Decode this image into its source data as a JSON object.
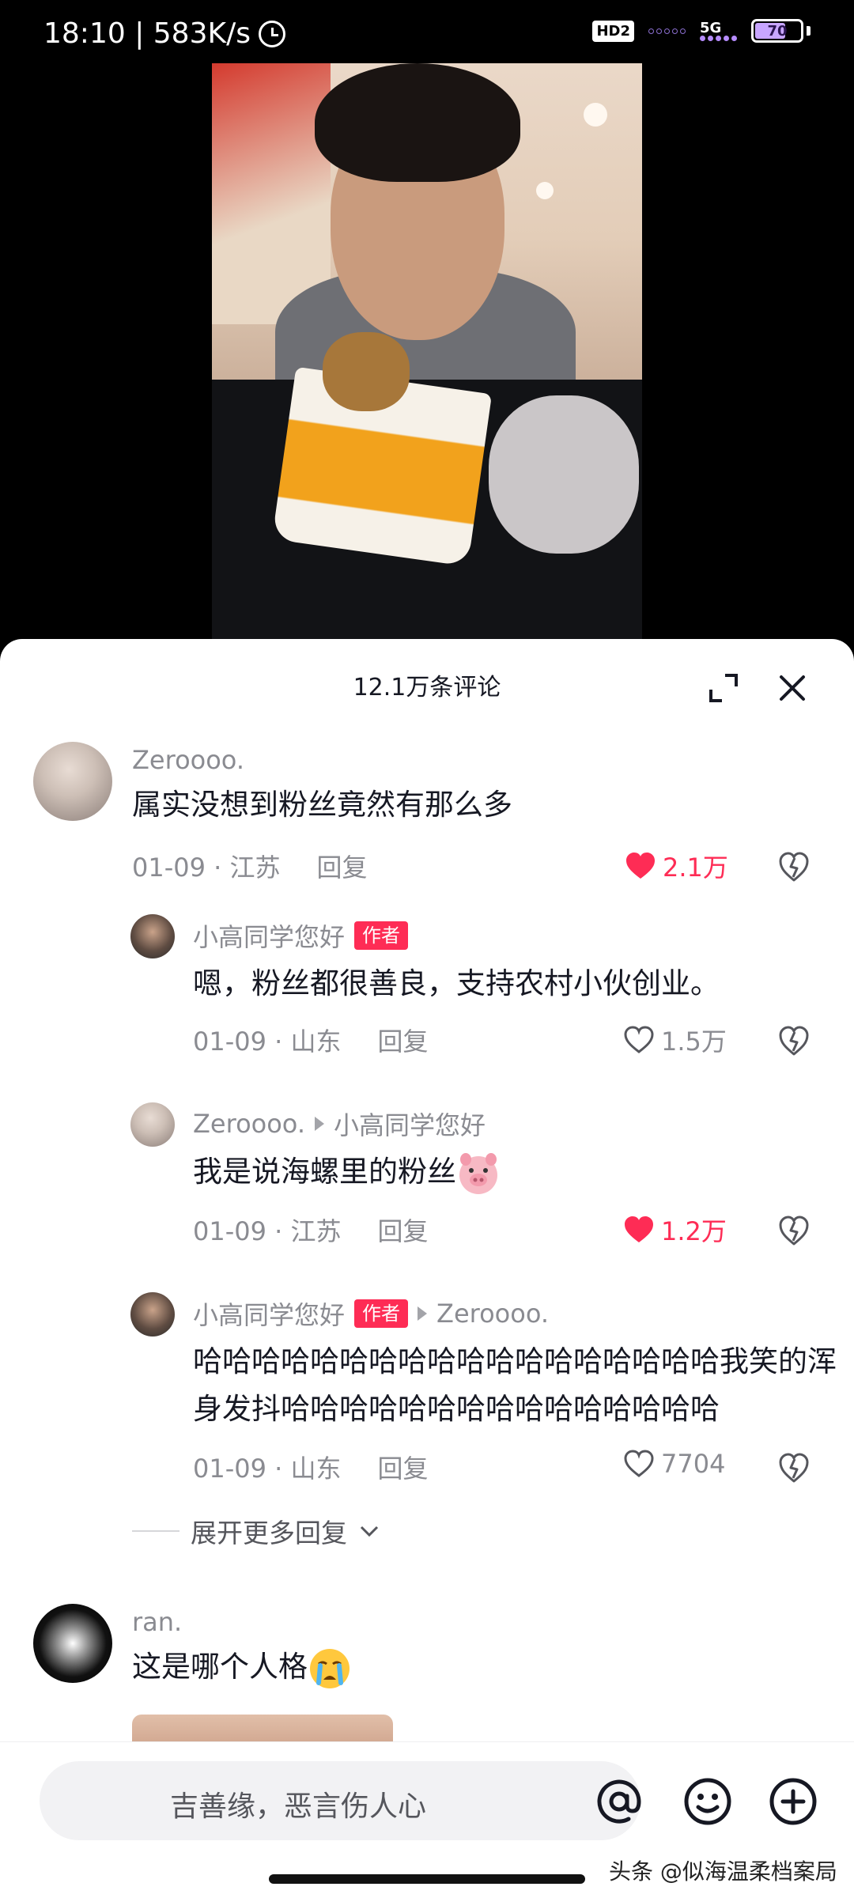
{
  "status_bar": {
    "time_speed": "18:10 | 583K/s",
    "hd_badge": "HD2",
    "network": "5G",
    "battery": "70",
    "battery_level": 0.7
  },
  "sheet": {
    "title": "12.1万条评论"
  },
  "comments": [
    {
      "username": "Zeroooo.",
      "text": "属实没想到粉丝竟然有那么多",
      "date_location": "01-09 · 江苏",
      "reply_label": "回复",
      "likes": "2.1万",
      "liked": true,
      "replies": [
        {
          "username": "小高同学您好",
          "author_tag": "作者",
          "text": "嗯，粉丝都很善良，支持农村小伙创业。",
          "date_location": "01-09 · 山东",
          "reply_label": "回复",
          "likes": "1.5万",
          "liked": false
        },
        {
          "username": "Zeroooo.",
          "reply_to": "小高同学您好",
          "text": "我是说海螺里的粉丝",
          "emoji": "pig-face-emoji",
          "date_location": "01-09 · 江苏",
          "reply_label": "回复",
          "likes": "1.2万",
          "liked": true
        },
        {
          "username": "小高同学您好",
          "author_tag": "作者",
          "reply_to": "Zeroooo.",
          "text_line1": "哈哈哈哈哈哈哈哈哈哈哈哈哈哈哈哈哈哈我笑的浑",
          "text_line2": "身发抖哈哈哈哈哈哈哈哈哈哈哈哈哈哈哈",
          "date_location": "01-09 · 山东",
          "reply_label": "回复",
          "likes": "7704",
          "liked": false
        }
      ],
      "more_replies_label": "展开更多回复"
    },
    {
      "username": "ran.",
      "text": "这是哪个人格",
      "emoji": "crying-face-emoji"
    }
  ],
  "input_bar": {
    "placeholder": "吉善缘，恶言伤人心"
  },
  "watermark": "头条 @似海温柔档案局",
  "colors": {
    "accent": "#fe2c55",
    "secondary_text": "#8a8b91",
    "primary_text": "#161823"
  }
}
